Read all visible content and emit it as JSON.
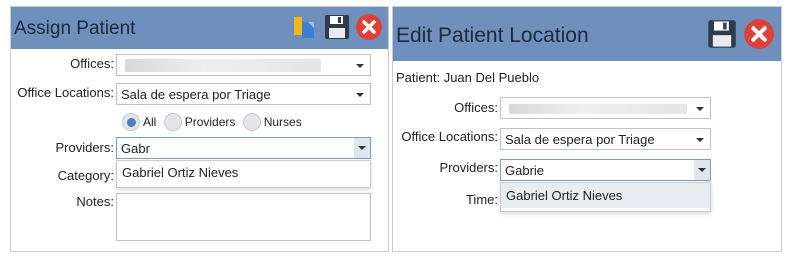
{
  "assign": {
    "title": "Assign Patient",
    "labels": {
      "offices": "Offices:",
      "office_locations": "Office Locations:",
      "providers": "Providers:",
      "category": "Category:",
      "notes": "Notes:"
    },
    "office_location_value": "Sala de espera por Triage",
    "radio": {
      "all": "All",
      "providers": "Providers",
      "nurses": "Nurses",
      "selected": "All"
    },
    "providers_value": "Gabr",
    "dropdown_items": [
      "Gabriel Ortiz Nieves"
    ],
    "icons": {
      "copy": "copy-icon",
      "save": "save-icon",
      "close": "close-icon"
    }
  },
  "edit": {
    "title": "Edit Patient Location",
    "patient_line": "Patient: Juan Del Pueblo",
    "labels": {
      "offices": "Offices:",
      "office_locations": "Office Locations:",
      "providers": "Providers:",
      "time": "Time:"
    },
    "office_location_value": "Sala de espera por Triage",
    "providers_value": "Gabrie",
    "dropdown_items": [
      "Gabriel Ortiz Nieves"
    ],
    "icons": {
      "save": "save-icon",
      "close": "close-icon"
    }
  },
  "colors": {
    "titlebar": "#6f8fbd",
    "close_red": "#e0403a",
    "save_dark": "#2f3b4b",
    "copy_yellow": "#f2b51c",
    "copy_blue": "#3b7fd4"
  }
}
